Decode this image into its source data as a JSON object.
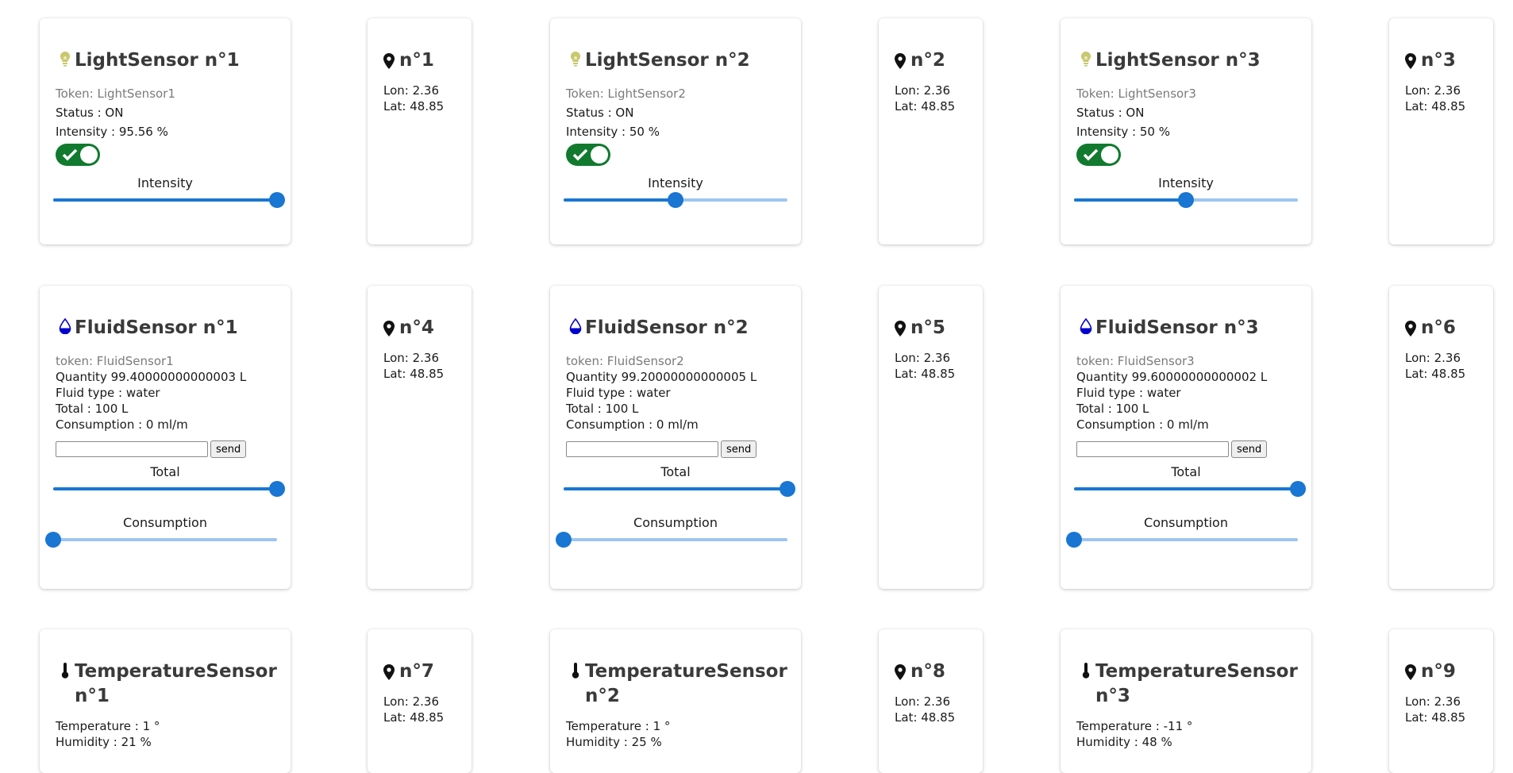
{
  "light_sensors": [
    {
      "title": "LightSensor n°1",
      "token": "Token: LightSensor1",
      "status": "Status : ON",
      "intensity": "Intensity : 95.56 %",
      "slider_label": "Intensity",
      "slider_value": 1.0
    },
    {
      "title": "LightSensor n°2",
      "token": "Token: LightSensor2",
      "status": "Status : ON",
      "intensity": "Intensity : 50 %",
      "slider_label": "Intensity",
      "slider_value": 0.5
    },
    {
      "title": "LightSensor n°3",
      "token": "Token: LightSensor3",
      "status": "Status : ON",
      "intensity": "Intensity : 50 %",
      "slider_label": "Intensity",
      "slider_value": 0.5
    }
  ],
  "fluid_sensors": [
    {
      "title": "FluidSensor n°1",
      "token": "token: FluidSensor1",
      "quantity": "Quantity 99.40000000000003 L",
      "fluid_type": "Fluid type : water",
      "total": "Total : 100 L",
      "consumption": "Consumption : 0 ml/m",
      "send_label": "send",
      "total_label": "Total",
      "total_value": 1.0,
      "consumption_label": "Consumption",
      "consumption_value": 0.0
    },
    {
      "title": "FluidSensor n°2",
      "token": "token: FluidSensor2",
      "quantity": "Quantity 99.20000000000005 L",
      "fluid_type": "Fluid type : water",
      "total": "Total : 100 L",
      "consumption": "Consumption : 0 ml/m",
      "send_label": "send",
      "total_label": "Total",
      "total_value": 1.0,
      "consumption_label": "Consumption",
      "consumption_value": 0.0
    },
    {
      "title": "FluidSensor n°3",
      "token": "token: FluidSensor3",
      "quantity": "Quantity 99.60000000000002 L",
      "fluid_type": "Fluid type : water",
      "total": "Total : 100 L",
      "consumption": "Consumption : 0 ml/m",
      "send_label": "send",
      "total_label": "Total",
      "total_value": 1.0,
      "consumption_label": "Consumption",
      "consumption_value": 0.0
    }
  ],
  "temperature_sensors": [
    {
      "title_line1": "TemperatureSensor",
      "title_line2": "n°1",
      "temperature": "Temperature : 1 °",
      "humidity": "Humidity : 21 %"
    },
    {
      "title_line1": "TemperatureSensor",
      "title_line2": "n°2",
      "temperature": "Temperature : 1 °",
      "humidity": "Humidity : 25 %"
    },
    {
      "title_line1": "TemperatureSensor",
      "title_line2": "n°3",
      "temperature": "Temperature : -11 °",
      "humidity": "Humidity : 48 %"
    }
  ],
  "locations": [
    {
      "label": "n°1",
      "lon": "Lon: 2.36",
      "lat": "Lat: 48.85"
    },
    {
      "label": "n°2",
      "lon": "Lon: 2.36",
      "lat": "Lat: 48.85"
    },
    {
      "label": "n°3",
      "lon": "Lon: 2.36",
      "lat": "Lat: 48.85"
    },
    {
      "label": "n°4",
      "lon": "Lon: 2.36",
      "lat": "Lat: 48.85"
    },
    {
      "label": "n°5",
      "lon": "Lon: 2.36",
      "lat": "Lat: 48.85"
    },
    {
      "label": "n°6",
      "lon": "Lon: 2.36",
      "lat": "Lat: 48.85"
    },
    {
      "label": "n°7",
      "lon": "Lon: 2.36",
      "lat": "Lat: 48.85"
    },
    {
      "label": "n°8",
      "lon": "Lon: 2.36",
      "lat": "Lat: 48.85"
    },
    {
      "label": "n°9",
      "lon": "Lon: 2.36",
      "lat": "Lat: 48.85"
    }
  ],
  "icons": {
    "light": "lightbulb-icon",
    "fluid": "water-drop-icon",
    "temperature": "thermometer-icon",
    "location": "map-pin-icon",
    "toggle": "check-icon"
  },
  "colors": {
    "toggle_on": "#117a2e",
    "slider": "#1976d2",
    "slider_rail": "#9ec5f0",
    "bulb": "#c8c86e",
    "drop": "#0000cc"
  }
}
